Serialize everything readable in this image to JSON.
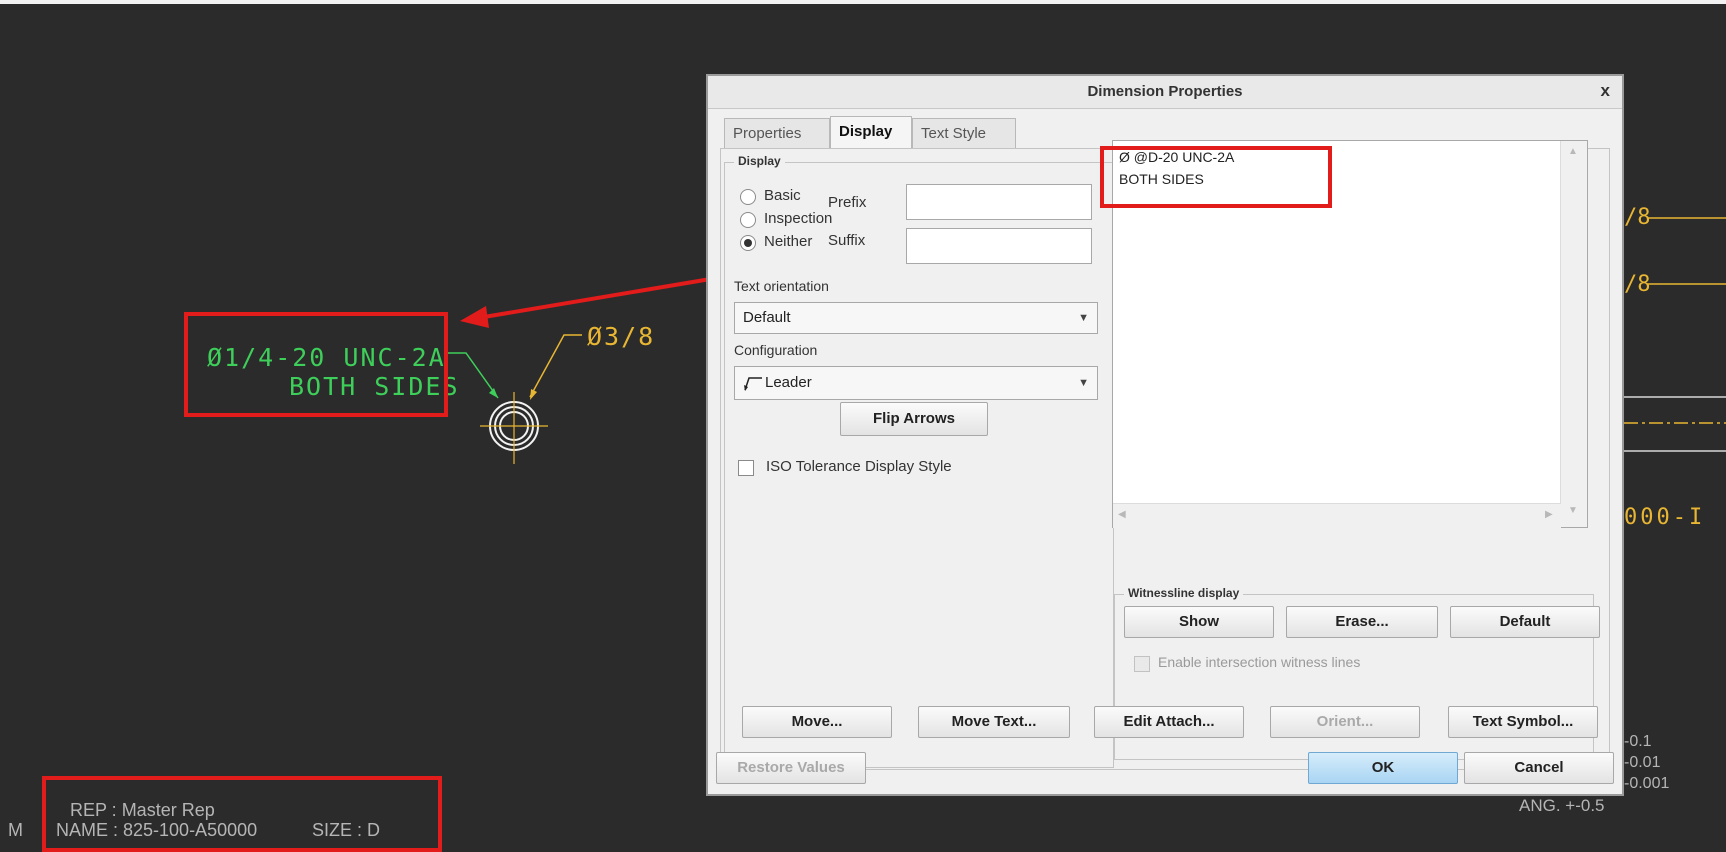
{
  "drawing": {
    "callout_line1": "Ø1/4-20 UNC-2A",
    "callout_line2": "BOTH SIDES",
    "dim_small": "Ø3/8",
    "right_text_1": "/8",
    "right_text_2": "/8",
    "right_text_3": "000-I",
    "tol_1": "-0.1",
    "tol_2": "-0.01",
    "tol_3": "-0.001",
    "tol_ang": "ANG. +-0.5",
    "rep_line": "REP : Master Rep",
    "name_prefix": "M",
    "name_line": "NAME : 825-100-A50000",
    "size_line": "SIZE : D"
  },
  "dialog": {
    "title": "Dimension Properties",
    "close_glyph": "x",
    "tabs": [
      "Properties",
      "Display",
      "Text Style"
    ],
    "display_group": "Display",
    "radio_options": [
      "Basic",
      "Inspection",
      "Neither"
    ],
    "prefix_label": "Prefix",
    "suffix_label": "Suffix",
    "text_orientation_label": "Text orientation",
    "text_orientation_value": "Default",
    "configuration_label": "Configuration",
    "configuration_value": "Leader",
    "flip_arrows": "Flip Arrows",
    "iso_tolerance": "ISO Tolerance Display Style",
    "dim_text_line1": "Ø @D-20 UNC-2A",
    "dim_text_line2": "BOTH SIDES",
    "witness_group": "Witnessline display",
    "show_btn": "Show",
    "erase_btn": "Erase...",
    "default_btn": "Default",
    "enable_intersection": "Enable intersection witness lines",
    "move_btn": "Move...",
    "move_text_btn": "Move Text...",
    "edit_attach_btn": "Edit Attach...",
    "orient_btn": "Orient...",
    "text_symbol_btn": "Text Symbol...",
    "restore_btn": "Restore Values",
    "ok_btn": "OK",
    "cancel_btn": "Cancel"
  },
  "colors": {
    "background": "#2b2b2b",
    "cad_green": "#3ecf5a",
    "cad_yellow": "#e8b632",
    "highlight_red": "#e21b1b"
  }
}
